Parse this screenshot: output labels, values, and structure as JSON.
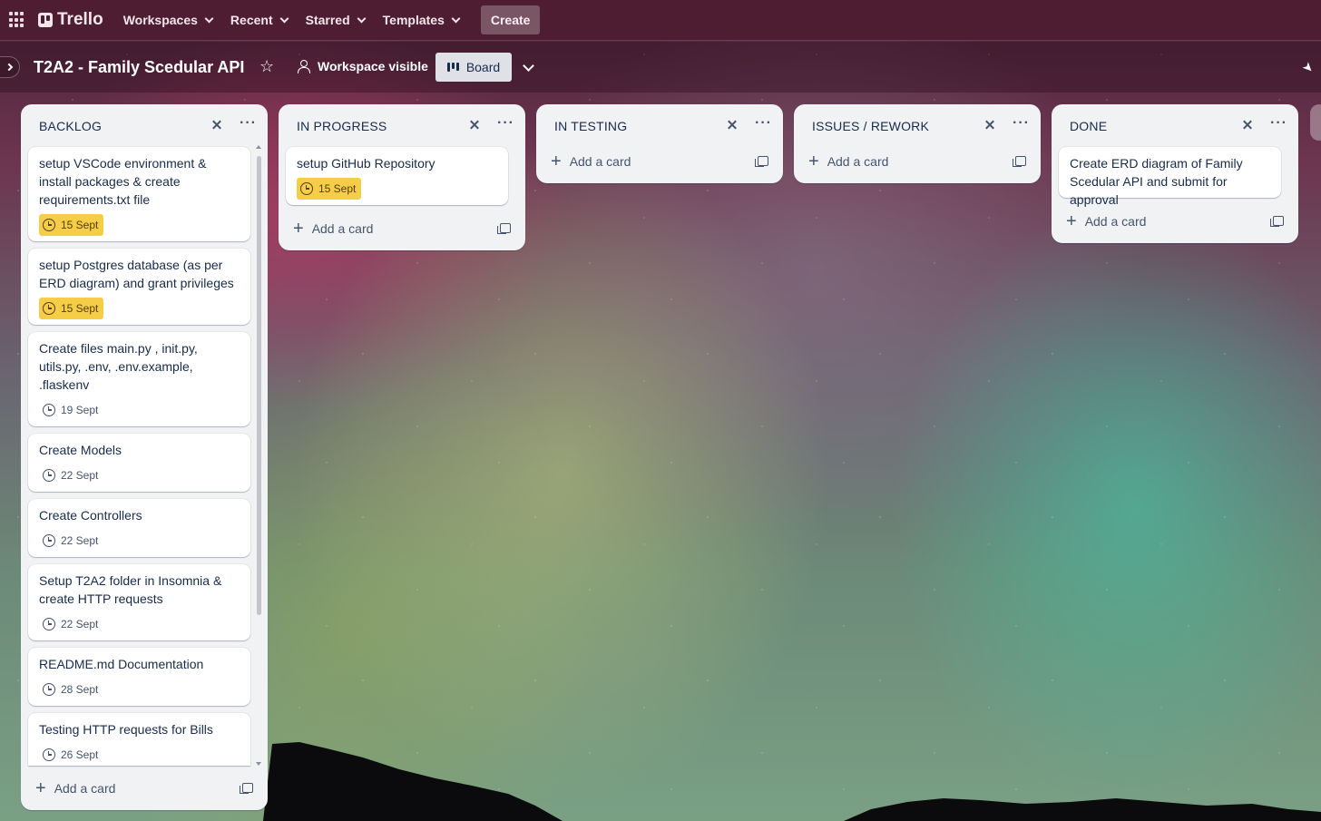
{
  "nav": {
    "logo_text": "Trello",
    "menus": [
      {
        "label": "Workspaces"
      },
      {
        "label": "Recent"
      },
      {
        "label": "Starred"
      },
      {
        "label": "Templates"
      }
    ],
    "create_label": "Create"
  },
  "board": {
    "title": "T2A2 - Family Scedular API",
    "visibility_label": "Workspace visible",
    "view_label": "Board"
  },
  "colors": {
    "nav_bg": "#4e1d31",
    "list_bg": "#f1f2f4",
    "due_soon": "#f5cd47",
    "text": "#172b4d"
  },
  "add_card_label": "Add a card",
  "lists": [
    {
      "title": "BACKLOG",
      "cards": [
        {
          "title": "setup VSCode environment & install packages & create requirements.txt file",
          "due": "15 Sept",
          "due_status": "soon"
        },
        {
          "title": "setup Postgres database (as per ERD diagram) and grant privileges",
          "due": "15 Sept",
          "due_status": "soon"
        },
        {
          "title": "Create files main.py , init.py, utils.py, .env, .env.example, .flaskenv",
          "due": "19 Sept",
          "due_status": "normal"
        },
        {
          "title": "Create Models",
          "due": "22 Sept",
          "due_status": "normal"
        },
        {
          "title": "Create Controllers",
          "due": "22 Sept",
          "due_status": "normal"
        },
        {
          "title": "Setup T2A2 folder in Insomnia & create HTTP requests",
          "due": "22 Sept",
          "due_status": "normal"
        },
        {
          "title": "README.md Documentation",
          "due": "28 Sept",
          "due_status": "normal"
        },
        {
          "title": "Testing HTTP requests for Bills",
          "due": "26 Sept",
          "due_status": "normal"
        }
      ]
    },
    {
      "title": "IN PROGRESS",
      "cards": [
        {
          "title": "setup GitHub Repository",
          "due": "15 Sept",
          "due_status": "soon"
        }
      ]
    },
    {
      "title": "IN TESTING",
      "cards": []
    },
    {
      "title": "ISSUES / REWORK",
      "cards": []
    },
    {
      "title": "DONE",
      "cards": [
        {
          "title": "Create ERD diagram of Family Scedular API and submit for approval",
          "due": "",
          "due_status": "none"
        }
      ]
    }
  ]
}
